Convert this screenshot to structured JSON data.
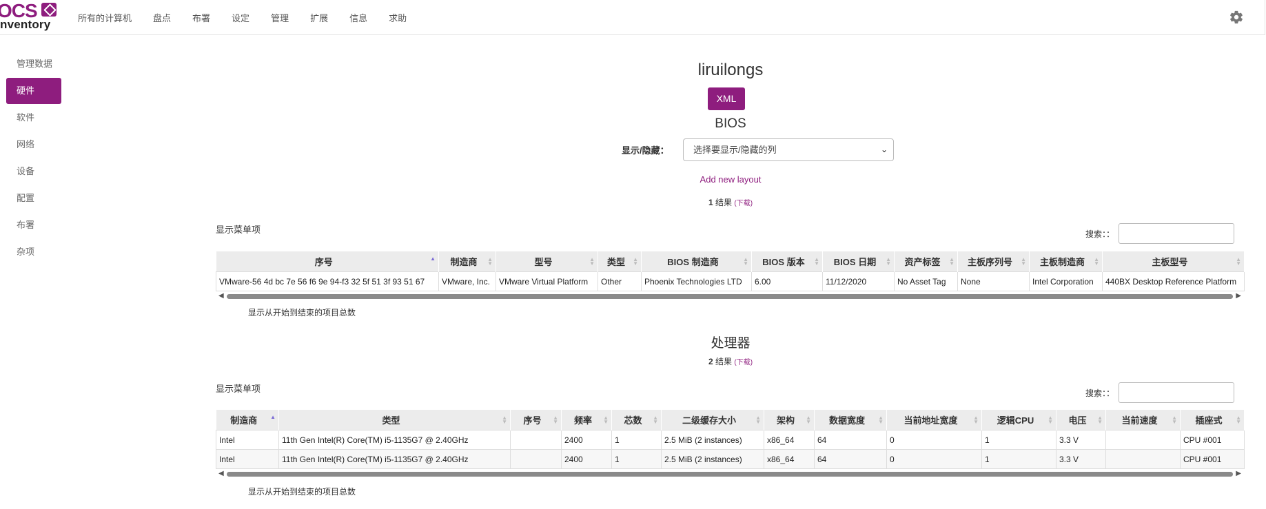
{
  "brand": {
    "top": "OCS",
    "bottom": "nventory"
  },
  "nav": [
    "所有的计算机",
    "盘点",
    "布署",
    "设定",
    "管理",
    "扩展",
    "信息",
    "求助"
  ],
  "sidebar": [
    "管理数据",
    "硬件",
    "软件",
    "网络",
    "设备",
    "配置",
    "布署",
    "杂项"
  ],
  "sidebar_active": "硬件",
  "page_title": "liruilongs",
  "xml_label": "XML",
  "bios": {
    "section_title": "BIOS",
    "show_hide_label": "显示/隐藏：",
    "select_placeholder": "选择要显示/隐藏的列",
    "add_layout": "Add new layout",
    "results_count": "1",
    "results_text": "结果",
    "download": "(下载)",
    "menu_label": "显示菜单项",
    "search_label": "搜索：：",
    "columns": [
      "序号",
      "制造商",
      "型号",
      "类型",
      "BIOS 制造商",
      "BIOS 版本",
      "BIOS 日期",
      "资产标签",
      "主板序列号",
      "主板制造商",
      "主板型号"
    ],
    "rows": [
      [
        "VMware-56 4d bc 7e 56 f6 9e 94-f3 32 5f 51 3f 93 51 67",
        "VMware, Inc.",
        "VMware Virtual Platform",
        "Other",
        "Phoenix Technologies LTD",
        "6.00",
        "11/12/2020",
        "No Asset Tag",
        "None",
        "Intel Corporation",
        "440BX Desktop Reference Platform"
      ]
    ],
    "footer": "显示从开始到结束的项目总数"
  },
  "cpu": {
    "section_title": "处理器",
    "results_count": "2",
    "results_text": "结果",
    "download": "(下载)",
    "menu_label": "显示菜单项",
    "search_label": "搜索：：",
    "columns": [
      "制造商",
      "类型",
      "序号",
      "频率",
      "芯数",
      "二级缓存大小",
      "架构",
      "数据宽度",
      "当前地址宽度",
      "逻辑CPU",
      "电压",
      "当前速度",
      "插座式"
    ],
    "rows": [
      [
        "Intel",
        "11th Gen Intel(R) Core(TM) i5-1135G7 @ 2.40GHz",
        "",
        "2400",
        "1",
        "2.5 MiB (2 instances)",
        "x86_64",
        "64",
        "0",
        "1",
        "3.3 V",
        "",
        "CPU #001"
      ],
      [
        "Intel",
        "11th Gen Intel(R) Core(TM) i5-1135G7 @ 2.40GHz",
        "",
        "2400",
        "1",
        "2.5 MiB (2 instances)",
        "x86_64",
        "64",
        "0",
        "1",
        "3.3 V",
        "",
        "CPU #001"
      ]
    ],
    "footer": "显示从开始到结束的项目总数"
  },
  "colors": {
    "accent": "#8e1d7e",
    "header_bg": "#ececec"
  }
}
